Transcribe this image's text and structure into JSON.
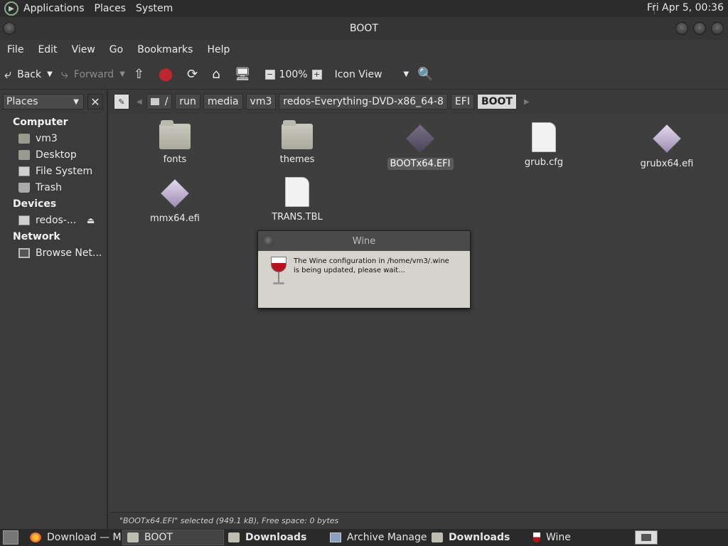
{
  "top_panel": {
    "menu": [
      "Applications",
      "Places",
      "System"
    ],
    "clock": "Fri Apr  5, 00:36"
  },
  "window": {
    "title": "BOOT",
    "menubar": [
      "File",
      "Edit",
      "View",
      "Go",
      "Bookmarks",
      "Help"
    ]
  },
  "toolbar": {
    "back": "Back",
    "forward": "Forward",
    "zoom": "100%",
    "view_mode": "Icon View"
  },
  "sidebar": {
    "header": "Places",
    "sections": [
      {
        "title": "Computer",
        "items": [
          "vm3",
          "Desktop",
          "File System",
          "Trash"
        ]
      },
      {
        "title": "Devices",
        "items": [
          "redos-..."
        ]
      },
      {
        "title": "Network",
        "items": [
          "Browse Net..."
        ]
      }
    ]
  },
  "pathbar": {
    "crumbs": [
      "/",
      "run",
      "media",
      "vm3",
      "redos-Everything-DVD-x86_64-8",
      "EFI",
      "BOOT"
    ]
  },
  "files": [
    {
      "name": "fonts",
      "type": "folder"
    },
    {
      "name": "themes",
      "type": "folder"
    },
    {
      "name": "BOOTx64.EFI",
      "type": "efi-dark",
      "selected": true
    },
    {
      "name": "grub.cfg",
      "type": "doc"
    },
    {
      "name": "grubx64.efi",
      "type": "efi-light"
    },
    {
      "name": "mmx64.efi",
      "type": "efi-light"
    },
    {
      "name": "TRANS.TBL",
      "type": "doc"
    }
  ],
  "status": "\"BOOTx64.EFI\" selected (949.1 kB), Free space: 0 bytes",
  "dialog": {
    "title": "Wine",
    "message": "The Wine configuration in /home/vm3/.wine is being updated, please wait..."
  },
  "taskbar": {
    "tasks": [
      {
        "label": "Download — M...",
        "icon": "firefox-icon"
      },
      {
        "label": "BOOT",
        "icon": "folder-icon",
        "active": true
      },
      {
        "label": "Downloads",
        "icon": "folder-icon",
        "bold": true
      },
      {
        "label": "Archive Manager",
        "icon": "archive-icon"
      },
      {
        "label": "Downloads",
        "icon": "folder-icon",
        "bold": true
      },
      {
        "label": "Wine",
        "icon": "wine-icon"
      }
    ]
  }
}
